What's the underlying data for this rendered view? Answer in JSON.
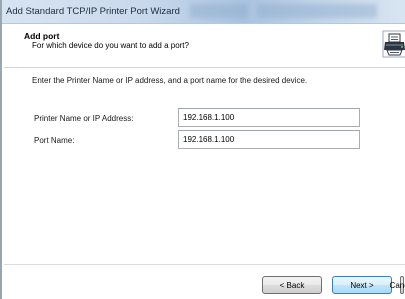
{
  "window": {
    "title": "Add Standard TCP/IP Printer Port Wizard"
  },
  "header": {
    "title": "Add port",
    "subtitle": "For which device do you want to add a port?",
    "icon": "printer-icon"
  },
  "main": {
    "instructions": "Enter the Printer Name or IP address, and a port name for the desired device.",
    "fields": [
      {
        "label": "Printer Name or IP Address:",
        "value": "192.168.1.100"
      },
      {
        "label": "Port Name:",
        "value": "192.168.1.100"
      }
    ]
  },
  "footer": {
    "back_label": "< Back",
    "next_label": "Next >",
    "cancel_label": "Cancel"
  }
}
